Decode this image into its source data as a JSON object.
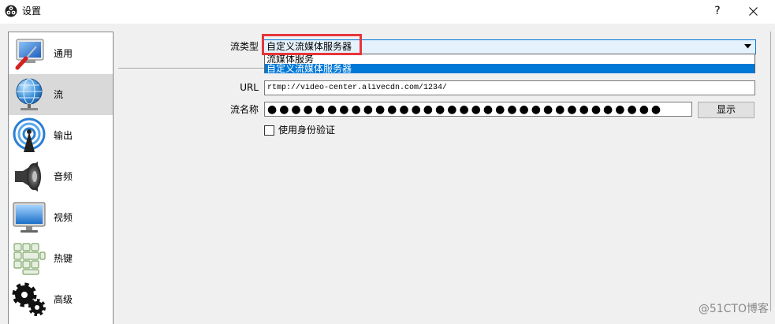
{
  "window": {
    "title": "设置",
    "help_label": "?"
  },
  "sidebar": {
    "items": [
      {
        "label": "通用",
        "icon": "general-settings-icon",
        "selected": false
      },
      {
        "label": "流",
        "icon": "globe-icon",
        "selected": true
      },
      {
        "label": "输出",
        "icon": "broadcast-icon",
        "selected": false
      },
      {
        "label": "音频",
        "icon": "speaker-icon",
        "selected": false
      },
      {
        "label": "视频",
        "icon": "monitor-icon",
        "selected": false
      },
      {
        "label": "热键",
        "icon": "keyboard-icon",
        "selected": false
      },
      {
        "label": "高级",
        "icon": "gears-icon",
        "selected": false
      }
    ]
  },
  "stream": {
    "type_label": "流类型",
    "type_value": "自定义流媒体服务器",
    "type_options": [
      "流媒体服务",
      "自定义流媒体服务器"
    ],
    "type_selected_index": 1,
    "url_label": "URL",
    "url_value": "rtmp://video-center.alivecdn.com/1234/",
    "key_label": "流名称",
    "key_value_masked": "●●●●●●●●●●●●●●●●●●●●●●●●●●●●●●●●●",
    "show_button_label": "显示",
    "auth_label": "使用身份验证",
    "auth_checked": false
  },
  "watermark": "@51CTO博客",
  "colors": {
    "accent": "#0078d7",
    "annotation": "#e8343b"
  }
}
